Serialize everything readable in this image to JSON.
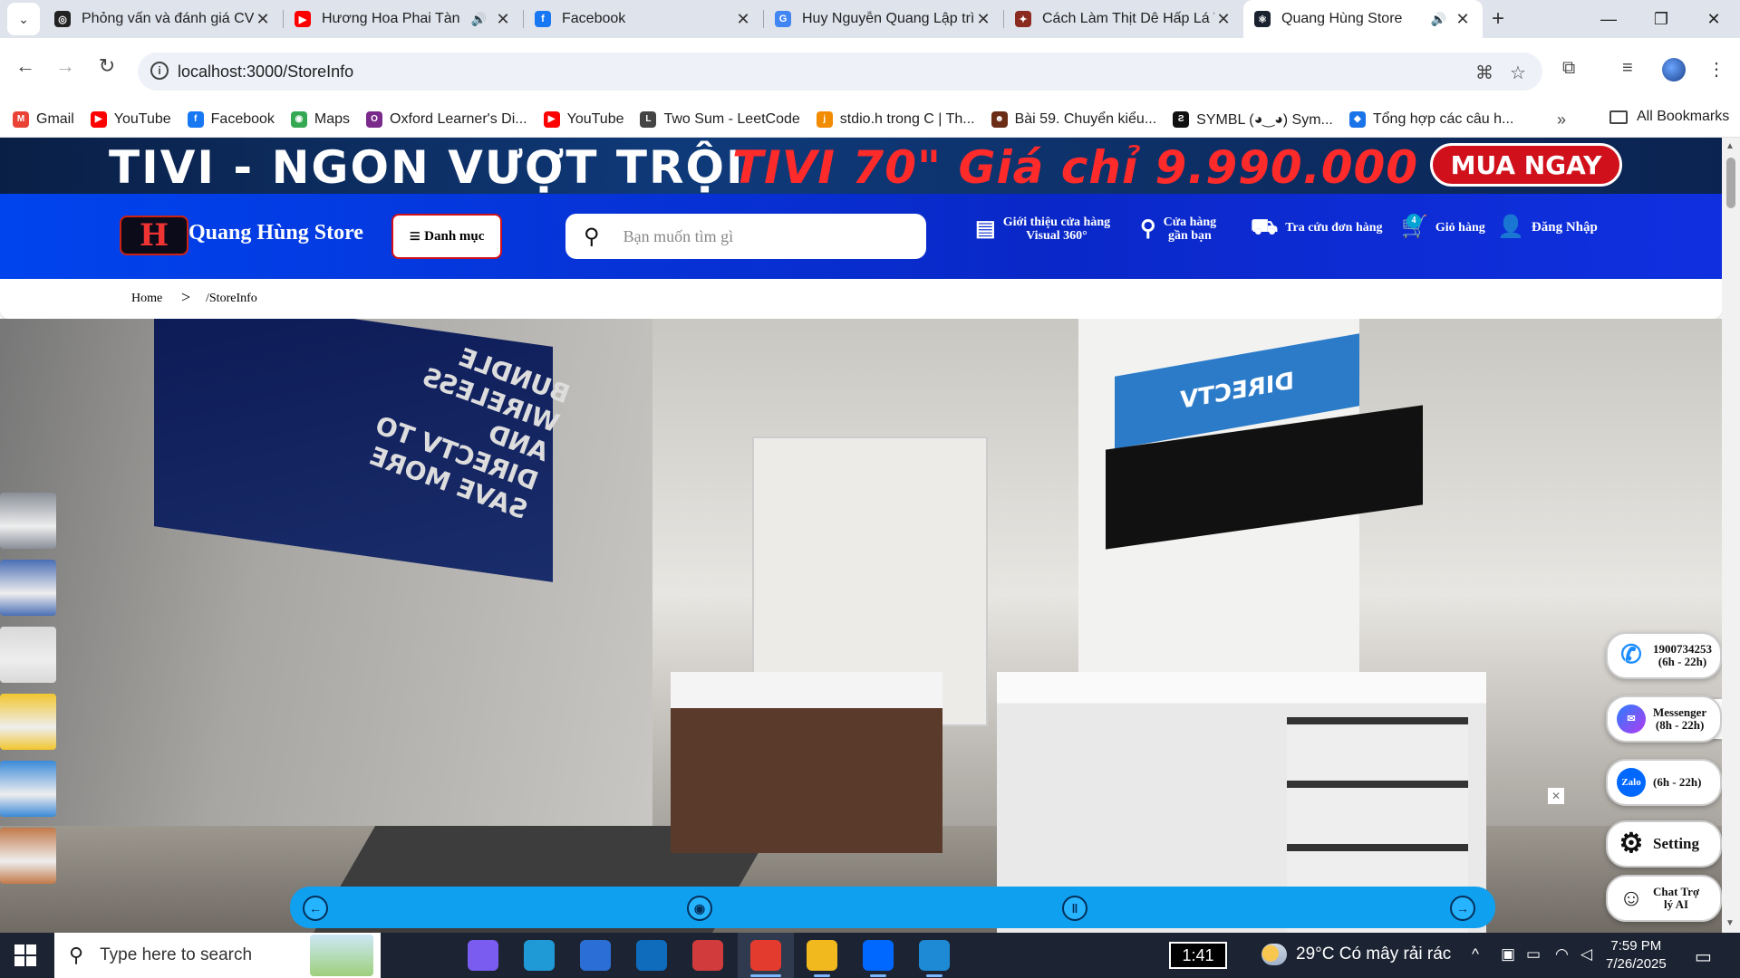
{
  "browser": {
    "tabs": [
      {
        "title": "Phỏng vấn và đánh giá CV",
        "icon": "openai-icon",
        "color": "#222222",
        "sound": false,
        "active": false
      },
      {
        "title": "Hương Hoa Phai Tàn (T",
        "icon": "youtube-icon",
        "color": "#ff0000",
        "sound": true,
        "active": false
      },
      {
        "title": "Facebook",
        "icon": "facebook-icon",
        "color": "#1877f2",
        "sound": false,
        "active": false
      },
      {
        "title": "Huy Nguyễn Quang Lập trì",
        "icon": "google-icon",
        "color": "#4285f4",
        "sound": false,
        "active": false
      },
      {
        "title": "Cách Làm Thịt Dê Hấp Lá T",
        "icon": "recipe-icon",
        "color": "#8b2b1f",
        "sound": false,
        "active": false
      },
      {
        "title": "Quang Hùng Store",
        "icon": "react-icon",
        "color": "#1a2230",
        "sound": true,
        "active": true
      }
    ],
    "url": "localhost:3000/StoreInfo",
    "bookmarks": [
      {
        "label": "Gmail",
        "icon": "gmail-icon",
        "color": "#ea4335"
      },
      {
        "label": "YouTube",
        "icon": "youtube-icon",
        "color": "#ff0000"
      },
      {
        "label": "Facebook",
        "icon": "facebook-icon",
        "color": "#1877f2"
      },
      {
        "label": "Maps",
        "icon": "maps-icon",
        "color": "#34a853"
      },
      {
        "label": "Oxford Learner's Di...",
        "icon": "oxford-icon",
        "color": "#7a2a8a"
      },
      {
        "label": "YouTube",
        "icon": "youtube-icon",
        "color": "#ff0000"
      },
      {
        "label": "Two Sum - LeetCode",
        "icon": "leetcode-icon",
        "color": "#444444"
      },
      {
        "label": "stdio.h trong C | Th...",
        "icon": "j-icon",
        "color": "#f28b00"
      },
      {
        "label": "Bài 59. Chuyển kiểu...",
        "icon": "person-icon",
        "color": "#6b2d16"
      },
      {
        "label": "SYMBL (◕‿◕) Sym...",
        "icon": "symbl-icon",
        "color": "#111111"
      },
      {
        "label": "Tổng hợp các câu h...",
        "icon": "diamond-icon",
        "color": "#1a73e8"
      }
    ],
    "all_bookmarks": "All Bookmarks"
  },
  "site": {
    "promo": {
      "left": "TIVI - NGON VƯỢT TRỘI",
      "middle": "TIVI 70\" Giá chỉ 9.990.000",
      "button": "MUA NGAY"
    },
    "header": {
      "logo_letter": "H",
      "store_name": "Quang Hùng Store",
      "category_button": "Danh mục",
      "search_placeholder": "Bạn muốn tìm gì",
      "nav": {
        "intro": "Giới thiệu cửa hàng\nVisual 360°",
        "nearby": "Cửa hàng\ngần bạn",
        "orders": "Tra cứu đơn hàng",
        "cart": "Giỏ hàng",
        "cart_count": "4",
        "login": "Đăng Nhập"
      }
    },
    "breadcrumb": {
      "home": "Home",
      "separator": ">",
      "current": "/StoreInfo"
    },
    "panorama": {
      "poster_text": "BUNDLE WIRELESS AND DIRECTV TO SAVE MORE",
      "brand_text": "DIRECTV",
      "thumbnails": [
        "#8a8f98",
        "#4a6fb5",
        "#d9d9d9",
        "#f2c62f",
        "#3b8ad8",
        "#c27a4a"
      ]
    },
    "contact": {
      "phone": "1900734253\n(6h - 22h)",
      "messenger": "Messenger\n(8h - 22h)",
      "zalo": "(6h - 22h)",
      "zalo_logo": "Zalo",
      "setting": "Setting",
      "chat_ai": "Chat Trợ\nlý AI"
    }
  },
  "taskbar": {
    "search_placeholder": "Type here to search",
    "clock_badge": "1:41",
    "weather": "29°C  Có mây rải rác",
    "time": "7:59 PM",
    "date": "7/26/2025",
    "apps": [
      {
        "name": "task-view-icon",
        "color": "#1c2433"
      },
      {
        "name": "copilot-icon",
        "color": "#7b5cf0"
      },
      {
        "name": "edge-icon",
        "color": "#1f9ad6"
      },
      {
        "name": "store-icon",
        "color": "#2b6fd6"
      },
      {
        "name": "outlook-icon",
        "color": "#0f6cbd"
      },
      {
        "name": "teams-icon",
        "color": "#d23b3b"
      },
      {
        "name": "chrome-icon",
        "color": "#e33b2e"
      },
      {
        "name": "explorer-icon",
        "color": "#f2b91e"
      },
      {
        "name": "zalo-icon",
        "color": "#0068ff"
      },
      {
        "name": "vscode-icon",
        "color": "#1e8ad6"
      }
    ]
  }
}
